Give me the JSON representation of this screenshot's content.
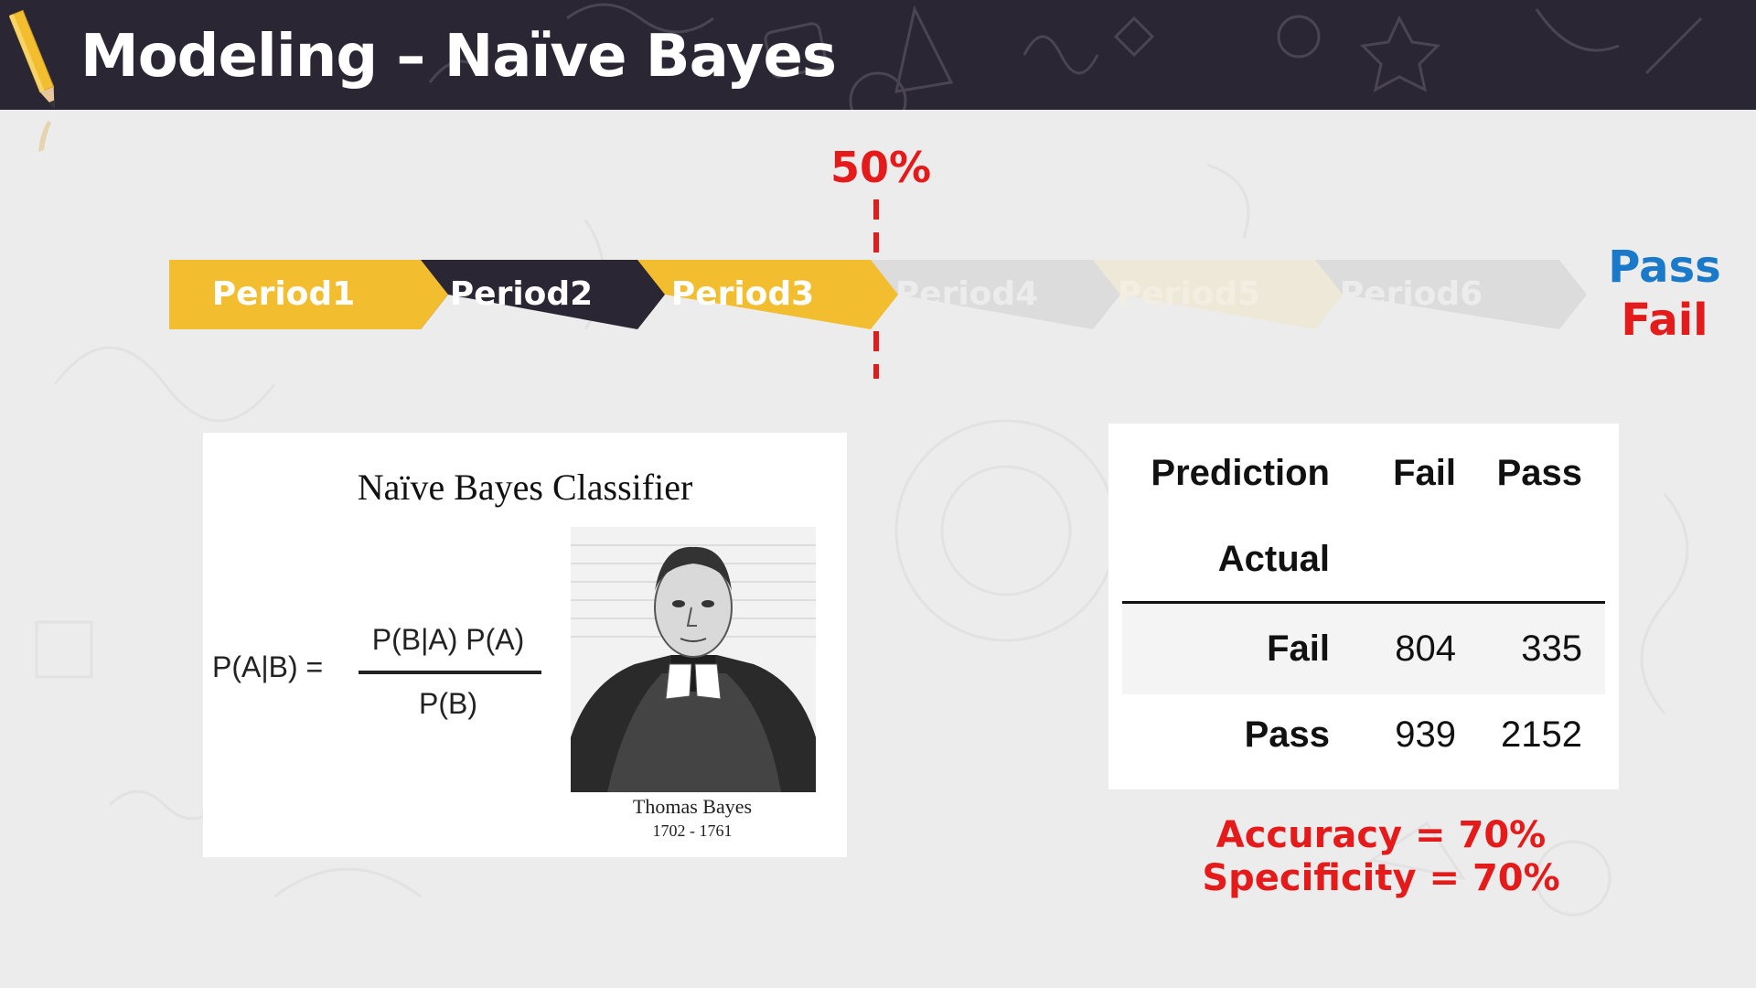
{
  "header": {
    "title": "Modeling – Naïve Bayes",
    "background": "#2b2633"
  },
  "timeline": {
    "threshold_label": "50%",
    "periods": [
      {
        "label": "Period1",
        "color": "#f2bd2f",
        "active": true
      },
      {
        "label": "Period2",
        "color": "#2b2633",
        "active": true
      },
      {
        "label": "Period3",
        "color": "#f2bd2f",
        "active": true
      },
      {
        "label": "Period4",
        "color": "#dcdcdc",
        "active": false
      },
      {
        "label": "Period5",
        "color": "#eee8d8",
        "active": false
      },
      {
        "label": "Period6",
        "color": "#dcdcdc",
        "active": false
      }
    ],
    "outcome_pass": "Pass",
    "outcome_fail": "Fail",
    "colors": {
      "threshold": "#e51b1b",
      "pass": "#1a7ac9",
      "fail": "#e51b1b"
    }
  },
  "nb_figure": {
    "title": "Naïve Bayes Classifier",
    "formula_lhs": "P(A|B) =",
    "formula_numerator": "P(B|A) P(A)",
    "formula_denominator": "P(B)",
    "portrait_name": "Thomas Bayes",
    "portrait_dates": "1702 - 1761"
  },
  "confusion_matrix": {
    "header_prediction": "Prediction",
    "header_actual": "Actual",
    "columns": [
      "Fail",
      "Pass"
    ],
    "rows": [
      {
        "label": "Fail",
        "values": [
          "804",
          "335"
        ]
      },
      {
        "label": "Pass",
        "values": [
          "939",
          "2152"
        ]
      }
    ]
  },
  "metrics": {
    "accuracy": "Accuracy =  70%",
    "specificity": "Specificity = 70%"
  }
}
